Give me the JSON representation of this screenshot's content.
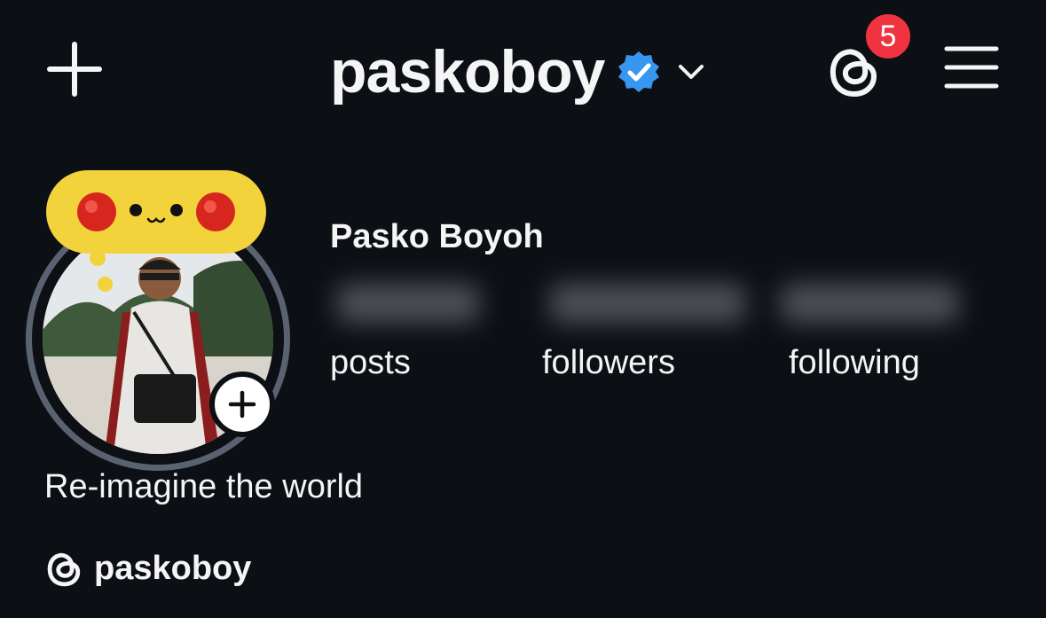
{
  "header": {
    "username": "paskoboy",
    "notifications_badge": "5"
  },
  "note": {
    "emoji_text": "🔴•ᴗ•🔴"
  },
  "profile": {
    "full_name": "Pasko Boyoh",
    "stats": {
      "posts_label": "posts",
      "followers_label": "followers",
      "following_label": "following"
    },
    "bio": "Re-imagine the world",
    "threads_handle": "paskoboy"
  },
  "icons": {
    "new_post": "plus-icon",
    "verified": "verified-badge-icon",
    "account_switcher": "chevron-down-icon",
    "threads": "threads-icon",
    "menu": "hamburger-menu-icon",
    "add_story": "plus-icon"
  },
  "colors": {
    "background": "#0c0f14",
    "text": "#f5f5f5",
    "verified_blue": "#3797f0",
    "badge_red": "#ef3340",
    "note_yellow": "#f3d33b",
    "ring_gray": "#5a6271"
  }
}
